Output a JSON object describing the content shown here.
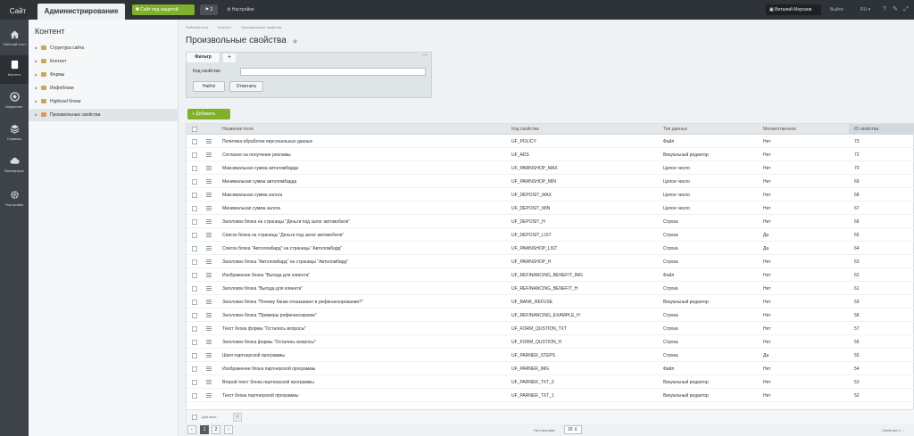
{
  "topbar": {
    "tab_site": "Сайт",
    "tab_admin": "Администрирование",
    "protect_button": "Сайт под защитой",
    "notifications_count": "2",
    "settings_label": "Настройки",
    "user_name": "Виталий Морозов",
    "logout": "Выйти",
    "lang": "RU"
  },
  "leftnav": {
    "items": [
      {
        "label": "Рабочий стол",
        "icon": "home-icon"
      },
      {
        "label": "Контент",
        "icon": "document-icon"
      },
      {
        "label": "Маркетинг",
        "icon": "target-icon"
      },
      {
        "label": "Сервисы",
        "icon": "layers-icon"
      },
      {
        "label": "Marketplace",
        "icon": "cloud-icon"
      },
      {
        "label": "Настройки",
        "icon": "gear-icon"
      }
    ]
  },
  "sidebar": {
    "title": "Контент",
    "items": [
      {
        "label": "Структура сайта"
      },
      {
        "label": "Контент"
      },
      {
        "label": "Формы"
      },
      {
        "label": "Инфоблоки"
      },
      {
        "label": "Highload блоки"
      },
      {
        "label": "Произвольные свойства"
      }
    ]
  },
  "main": {
    "breadcrumb": [
      "Рабочий стол",
      "Контент",
      "Произвольные свойства"
    ],
    "title": "Произвольные свойства",
    "filter": {
      "tab": "Фильтр",
      "add": "+",
      "collapse": "—",
      "field_label": "Код свойства",
      "field_value": "",
      "find": "Найти",
      "cancel": "Отменить"
    },
    "add_button": "Добавить"
  },
  "grid": {
    "headers": {
      "name": "Название поля",
      "code": "Код свойства",
      "type": "Тип данных",
      "multiple": "Множественное",
      "id": "ID свойства"
    },
    "rows": [
      {
        "name": "Политика обработки персональных данных",
        "code": "UF_POLICY",
        "type": "Файл",
        "multiple": "Нет",
        "id": "73"
      },
      {
        "name": "Согласие на получение рекламы",
        "code": "UF_ADS",
        "type": "Визуальный редактор",
        "multiple": "Нет",
        "id": "72"
      },
      {
        "name": "Максимальная сумма автоломбарда",
        "code": "UF_PAWNSHOP_MAX",
        "type": "Целое число",
        "multiple": "Нет",
        "id": "70"
      },
      {
        "name": "Минимальная сумма автоломбарда",
        "code": "UF_PAWNSHOP_MIN",
        "type": "Целое число",
        "multiple": "Нет",
        "id": "69"
      },
      {
        "name": "Максимальная сумма залога",
        "code": "UF_DEPOSIT_MAX",
        "type": "Целое число",
        "multiple": "Нет",
        "id": "68"
      },
      {
        "name": "Минимальная сумма залога",
        "code": "UF_DEPOSIT_MIN",
        "type": "Целое число",
        "multiple": "Нет",
        "id": "67"
      },
      {
        "name": "Заголовок блока на страницы \"Деньги под залог автомобиля\"",
        "code": "UF_DEPOSIT_H",
        "type": "Строка",
        "multiple": "Нет",
        "id": "66"
      },
      {
        "name": "Список блока на страницы \"Деньги под залог автомобиля\"",
        "code": "UF_DEPOSIT_LIST",
        "type": "Строка",
        "multiple": "Да",
        "id": "65"
      },
      {
        "name": "Список блока \"Автоломбард\" на страницы \"Автоломбард\"",
        "code": "UF_PAWNSHOP_LIST",
        "type": "Строка",
        "multiple": "Да",
        "id": "64"
      },
      {
        "name": "Заголовок блока \"Автоломбард\" на страницы \"Автоломбард\"",
        "code": "UF_PAWNSHOP_H",
        "type": "Строка",
        "multiple": "Нет",
        "id": "63"
      },
      {
        "name": "Изображение блока \"Выгода для клиента\"",
        "code": "UF_REFINANCING_BENEFIT_IMG",
        "type": "Файл",
        "multiple": "Нет",
        "id": "62"
      },
      {
        "name": "Заголовок блока \"Выгода для клиента\"",
        "code": "UF_REFINANCING_BENEFIT_H",
        "type": "Строка",
        "multiple": "Нет",
        "id": "61"
      },
      {
        "name": "Заголовок блока \"Почему банки отказывают в рефинансировании?\"",
        "code": "UF_BANK_REFUSE",
        "type": "Визуальный редактор",
        "multiple": "Нет",
        "id": "59"
      },
      {
        "name": "Заголовок блока \"Примеры рефинансировки\"",
        "code": "UF_REFINANCING_EXAMPLE_H",
        "type": "Строка",
        "multiple": "Нет",
        "id": "58"
      },
      {
        "name": "Текст блока формы \"Остались вопросы\"",
        "code": "UF_FORM_QUSTION_TXT",
        "type": "Строка",
        "multiple": "Нет",
        "id": "57"
      },
      {
        "name": "Заголовок блока формы \"Остались вопросы\"",
        "code": "UF_FORM_QUSTION_H",
        "type": "Строка",
        "multiple": "Нет",
        "id": "56"
      },
      {
        "name": "Шаги партнерской программы",
        "code": "UF_PARNER_STEPS",
        "type": "Строка",
        "multiple": "Да",
        "id": "55"
      },
      {
        "name": "Изображение блока партнерской программы",
        "code": "UF_PARNER_IMG",
        "type": "Файл",
        "multiple": "Нет",
        "id": "54"
      },
      {
        "name": "Второй текст блока партнерской программы",
        "code": "UF_PARNER_TXT_2",
        "type": "Визуальный редактор",
        "multiple": "Нет",
        "id": "53"
      },
      {
        "name": "Текст блока партнерской программы",
        "code": "UF_PARNER_TXT_1",
        "type": "Визуальный редактор",
        "multiple": "Нет",
        "id": "52"
      }
    ],
    "footer_label": "Для всех",
    "footer_action": "✕"
  },
  "pager": {
    "prev": "‹",
    "pages": [
      "1",
      "2"
    ],
    "next": "›",
    "per_page_label": "На странице:",
    "per_page_value": "20",
    "total": "Свойства 1 –"
  },
  "colors": {
    "topbar": "#2e3338",
    "leftnav": "#3d4349",
    "accent_green": "#7fb12a"
  }
}
